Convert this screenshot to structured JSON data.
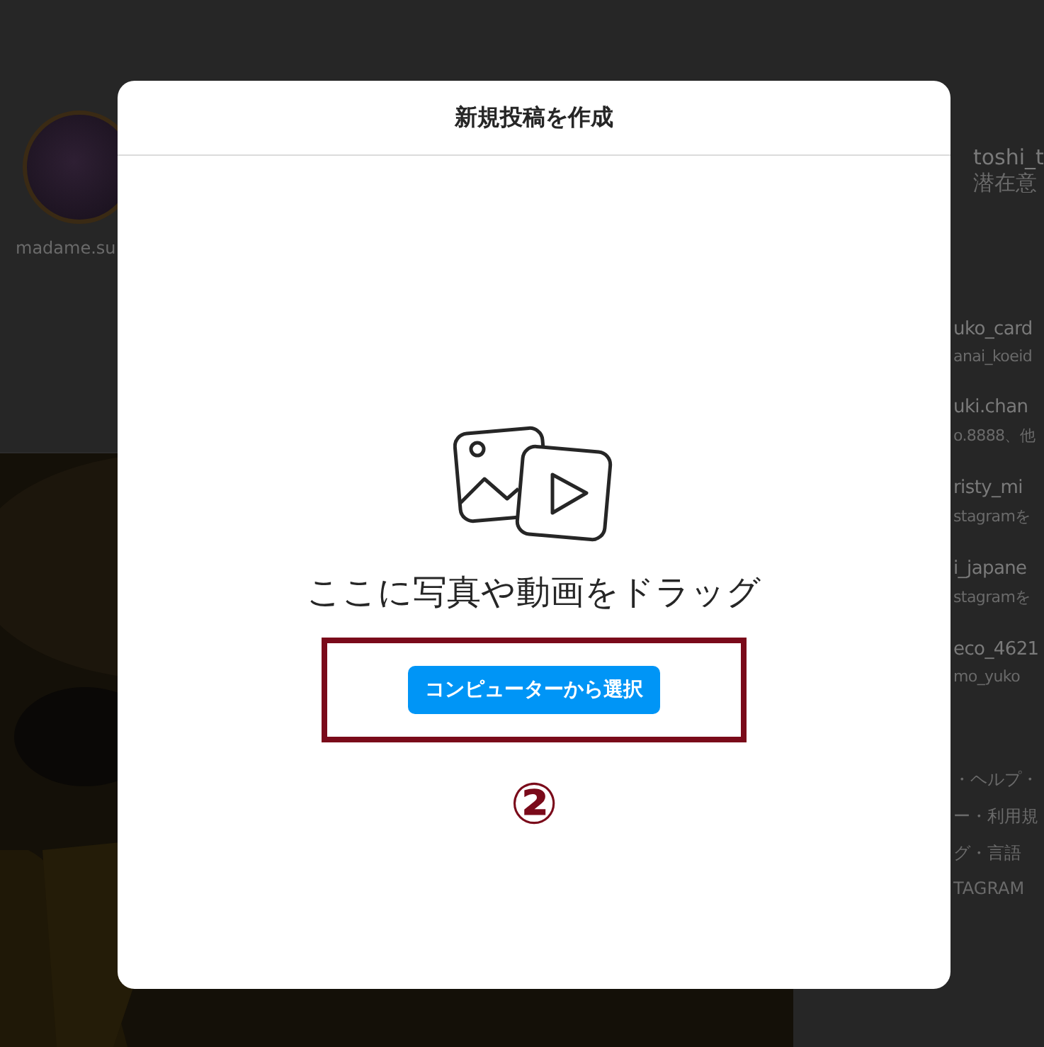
{
  "background": {
    "story": {
      "name": "madame.su"
    },
    "profile": {
      "name": "toshi_t",
      "subtitle": "潜在意"
    },
    "suggestions": [
      {
        "name": "uko_card",
        "sub": "anai_koeid"
      },
      {
        "name": "uki.chan",
        "sub": "o.8888、他"
      },
      {
        "name": "risty_mi",
        "sub": "stagramを"
      },
      {
        "name": "i_japane",
        "sub": "stagramを"
      },
      {
        "name": "eco_4621",
        "sub": "mo_yuko"
      }
    ],
    "footer": [
      "・ヘルプ・",
      "ー・利用規",
      "グ・言語",
      "TAGRAM"
    ],
    "post": {
      "kind": "picture"
    }
  },
  "modal": {
    "title": "新規投稿を作成",
    "prompt": "ここに写真や動画をドラッグ",
    "button": "コンピューターから選択",
    "annotation": "②"
  }
}
